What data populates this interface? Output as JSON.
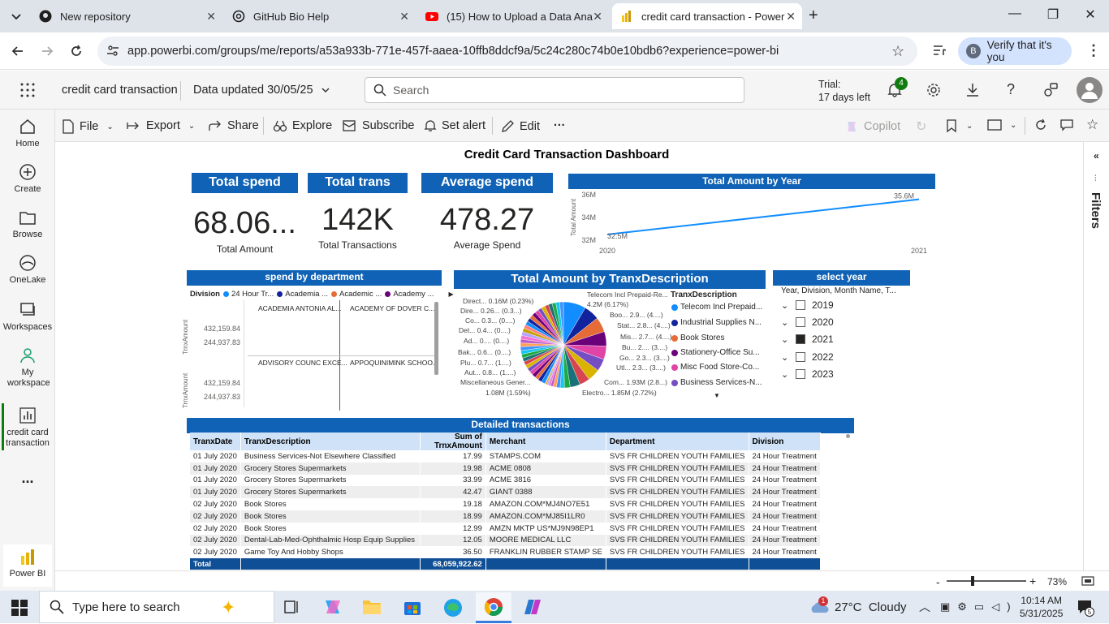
{
  "browser": {
    "tabs": [
      {
        "title": "New repository",
        "icon": "github-icon"
      },
      {
        "title": "GitHub Bio Help",
        "icon": "chatgpt-icon"
      },
      {
        "title": "(15) How to Upload a Data Ana",
        "icon": "youtube-icon"
      },
      {
        "title": "credit card transaction - Power",
        "icon": "powerbi-icon",
        "active": true
      }
    ],
    "url": "app.powerbi.com/groups/me/reports/a53a933b-771e-457f-aaea-10ffb8ddcf9a/5c24c280c74b0e10bdb6?experience=power-bi",
    "verify_label": "Verify that it's you",
    "profile_initial": "B"
  },
  "header": {
    "report_name": "credit card transaction",
    "data_updated": "Data updated 30/05/25",
    "search_placeholder": "Search",
    "trial_line1": "Trial:",
    "trial_line2": "17 days left",
    "notif_count": "4"
  },
  "leftnav": {
    "items": [
      {
        "label": "Home"
      },
      {
        "label": "Create"
      },
      {
        "label": "Browse"
      },
      {
        "label": "OneLake"
      },
      {
        "label": "Workspaces"
      },
      {
        "label": "My workspace"
      },
      {
        "label": "credit card transaction"
      }
    ],
    "more": "...",
    "brand": "Power BI"
  },
  "ribbon": {
    "file": "File",
    "export": "Export",
    "share": "Share",
    "explore": "Explore",
    "subscribe": "Subscribe",
    "alert": "Set alert",
    "edit": "Edit",
    "more": "···",
    "copilot": "Copilot"
  },
  "report": {
    "title": "Credit Card Transaction Dashboard",
    "kpis": [
      {
        "header": "Total spend",
        "value": "68.06...",
        "label": "Total Amount"
      },
      {
        "header": "Total trans",
        "value": "142K",
        "label": "Total Transactions"
      },
      {
        "header": "Average spend",
        "value": "478.27",
        "label": "Average Spend"
      }
    ],
    "line_title": "Total Amount by Year",
    "dept_title": "spend by department",
    "dept_legend_title": "Division",
    "dept_legend": [
      {
        "label": "24 Hour Tr...",
        "color": "#118dff"
      },
      {
        "label": "Academia ...",
        "color": "#12239e"
      },
      {
        "label": "Academic ...",
        "color": "#e66c37"
      },
      {
        "label": "Academy ...",
        "color": "#6b007b"
      }
    ],
    "dept_axis_label": "TrnxAmount",
    "dept_cells": [
      {
        "name": "ACADEMIA ANTONIA AL...",
        "v1": "432,159.84",
        "v2": "244,937.83"
      },
      {
        "name": "ACADEMY OF DOVER C..."
      },
      {
        "name": "ADVISORY COUNC EXCE...",
        "v1": "432,159.84",
        "v2": "244,937.83"
      },
      {
        "name": "APPOQUINIMINK SCHOO..."
      }
    ],
    "pie_title": "Total Amount by TranxDescription",
    "pie_legend_title": "TranxDescription",
    "pie_legend": [
      {
        "label": "Telecom Incl Prepaid...",
        "color": "#118dff"
      },
      {
        "label": "Industrial Supplies N...",
        "color": "#12239e"
      },
      {
        "label": "Book Stores",
        "color": "#e66c37"
      },
      {
        "label": "Stationery-Office Su...",
        "color": "#6b007b"
      },
      {
        "label": "Misc Food Store-Co...",
        "color": "#e044a7"
      },
      {
        "label": "Business Services-N...",
        "color": "#744ec2"
      }
    ],
    "pie_labels_right": [
      "Telecom Incl Prepaid-Re...",
      "4.2M (6.17%)",
      "Boo... 2.9... (4....)",
      "Stat... 2.8... (4....)",
      "Mis... 2.7... (4....)",
      "Bu... 2.... (3....)",
      "Go... 2.3... (3....)",
      "Utl... 2.3... (3....)",
      "Com... 1.93M (2.8...)",
      "Electro... 1.85M (2.72%)"
    ],
    "pie_labels_left": [
      "Direct... 0.16M (0.23%)",
      "Dire... 0.26... (0.3...)",
      "Co... 0.3... (0....)",
      "Det... 0.4... (0....)",
      "Ad... 0.... (0....)",
      "Bak... 0.6... (0....)",
      "Plu... 0.7... (1....)",
      "Aut... 0.8... (1....)",
      "Miscellaneous Gener...",
      "1.08M (1.59%)"
    ],
    "slicer_title": "select year",
    "slicer_sub": "Year, Division, Month Name, T...",
    "slicer_items": [
      {
        "label": "2019",
        "checked": false
      },
      {
        "label": "2020",
        "checked": false
      },
      {
        "label": "2021",
        "checked": true
      },
      {
        "label": "2022",
        "checked": false
      },
      {
        "label": "2023",
        "checked": false
      }
    ],
    "table_title": "Detailed transactions",
    "table_headers": [
      "TranxDate",
      "TranxDescription",
      "Sum of TrnxAmount",
      "Merchant",
      "Department",
      "Division"
    ],
    "table_rows": [
      [
        "01 July 2020",
        "Business Services-Not Elsewhere Classified",
        "17.99",
        "STAMPS.COM",
        "SVS FR CHILDREN YOUTH FAMILIES",
        "24 Hour Treatment"
      ],
      [
        "01 July 2020",
        "Grocery Stores Supermarkets",
        "19.98",
        "ACME 0808",
        "SVS FR CHILDREN YOUTH FAMILIES",
        "24 Hour Treatment"
      ],
      [
        "01 July 2020",
        "Grocery Stores Supermarkets",
        "33.99",
        "ACME 3816",
        "SVS FR CHILDREN YOUTH FAMILIES",
        "24 Hour Treatment"
      ],
      [
        "01 July 2020",
        "Grocery Stores Supermarkets",
        "42.47",
        "GIANT 0388",
        "SVS FR CHILDREN YOUTH FAMILIES",
        "24 Hour Treatment"
      ],
      [
        "02 July 2020",
        "Book Stores",
        "19.18",
        "AMAZON.COM*MJ4NO7E51",
        "SVS FR CHILDREN YOUTH FAMILIES",
        "24 Hour Treatment"
      ],
      [
        "02 July 2020",
        "Book Stores",
        "18.99",
        "AMAZON.COM*MJ85I1LR0",
        "SVS FR CHILDREN YOUTH FAMILIES",
        "24 Hour Treatment"
      ],
      [
        "02 July 2020",
        "Book Stores",
        "12.99",
        "AMZN MKTP US*MJ9N98EP1",
        "SVS FR CHILDREN YOUTH FAMILIES",
        "24 Hour Treatment"
      ],
      [
        "02 July 2020",
        "Dental-Lab-Med-Ophthalmic Hosp Equip Supplies",
        "12.05",
        "MOORE MEDICAL LLC",
        "SVS FR CHILDREN YOUTH FAMILIES",
        "24 Hour Treatment"
      ],
      [
        "02 July 2020",
        "Game Toy And Hobby Shops",
        "36.50",
        "FRANKLIN RUBBER STAMP SE",
        "SVS FR CHILDREN YOUTH FAMILIES",
        "24 Hour Treatment"
      ]
    ],
    "table_total_label": "Total",
    "table_total_value": "68,059,922.62",
    "filters_label": "Filters",
    "zoom": "73%"
  },
  "chart_data": [
    {
      "type": "line",
      "title": "Total Amount by Year",
      "x": [
        "2020",
        "2021"
      ],
      "series": [
        {
          "values": [
            32.5,
            35.6
          ]
        }
      ],
      "point_labels": [
        "32.5M",
        "35.6M"
      ],
      "ylabel": "Total Amount",
      "yticks": [
        "32M",
        "34M",
        "36M"
      ],
      "ylim": [
        32,
        36
      ],
      "color": "#118dff"
    },
    {
      "type": "pie",
      "title": "Total Amount by TranxDescription",
      "slices": [
        {
          "label": "Telecom Incl Prepaid-Re...",
          "value": 4.2,
          "pct": 6.17
        },
        {
          "label": "Boo...",
          "value": 2.9
        },
        {
          "label": "Stat...",
          "value": 2.8
        },
        {
          "label": "Mis...",
          "value": 2.7
        },
        {
          "label": "Bu...",
          "value": 2.5
        },
        {
          "label": "Go...",
          "value": 2.3
        },
        {
          "label": "Utl...",
          "value": 2.3
        },
        {
          "label": "Com...",
          "value": 1.93,
          "pct": 2.8
        },
        {
          "label": "Electro...",
          "value": 1.85,
          "pct": 2.72
        },
        {
          "label": "Miscellaneous Gener...",
          "value": 1.08,
          "pct": 1.59
        },
        {
          "label": "Aut...",
          "value": 0.8
        },
        {
          "label": "Plu...",
          "value": 0.7
        },
        {
          "label": "Bak...",
          "value": 0.6
        },
        {
          "label": "Ad...",
          "value": 0.5
        },
        {
          "label": "Det...",
          "value": 0.4
        },
        {
          "label": "Co...",
          "value": 0.3
        },
        {
          "label": "Dire...",
          "value": 0.26
        },
        {
          "label": "Direct...",
          "value": 0.16,
          "pct": 0.23
        }
      ],
      "colors": [
        "#118dff",
        "#12239e",
        "#e66c37",
        "#6b007b",
        "#e044a7",
        "#744ec2",
        "#d9b300",
        "#d64550",
        "#197278",
        "#1aab40",
        "#15c6f4",
        "#4092ff",
        "#ffa058",
        "#be5dc9",
        "#f472d0",
        "#b5a1ff",
        "#c4a200",
        "#ff8080"
      ]
    }
  ],
  "taskbar": {
    "search_placeholder": "Type here to search",
    "weather": "27°C  Cloudy",
    "time": "10:14 AM",
    "date": "5/31/2025",
    "notif_badge": "5",
    "weather_badge": "1"
  }
}
